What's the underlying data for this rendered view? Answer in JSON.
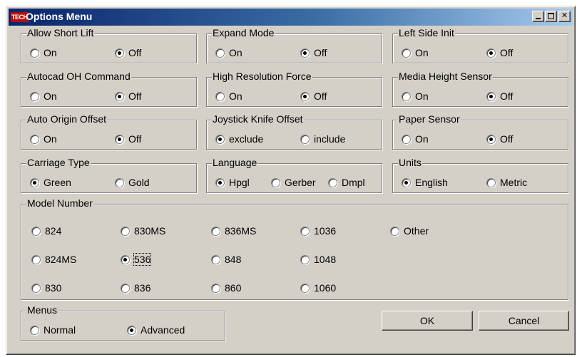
{
  "window": {
    "logo": "TECH",
    "title": "Options Menu"
  },
  "groups": {
    "allow_short_lift": {
      "title": "Allow Short Lift",
      "options": [
        "On",
        "Off"
      ],
      "selected": "Off"
    },
    "expand_mode": {
      "title": "Expand Mode",
      "options": [
        "On",
        "Off"
      ],
      "selected": "Off"
    },
    "left_side_init": {
      "title": "Left Side Init",
      "options": [
        "On",
        "Off"
      ],
      "selected": "Off"
    },
    "autocad_oh": {
      "title": "Autocad OH Command",
      "options": [
        "On",
        "Off"
      ],
      "selected": "Off"
    },
    "high_res": {
      "title": "High Resolution Force",
      "options": [
        "On",
        "Off"
      ],
      "selected": "Off"
    },
    "media_height": {
      "title": "Media Height Sensor",
      "options": [
        "On",
        "Off"
      ],
      "selected": "Off"
    },
    "auto_origin": {
      "title": "Auto Origin Offset",
      "options": [
        "On",
        "Off"
      ],
      "selected": "Off"
    },
    "joystick_knife": {
      "title": "Joystick Knife Offset",
      "options": [
        "exclude",
        "include"
      ],
      "selected": "exclude"
    },
    "paper_sensor": {
      "title": "Paper Sensor",
      "options": [
        "On",
        "Off"
      ],
      "selected": "Off"
    },
    "carriage_type": {
      "title": "Carriage Type",
      "options": [
        "Green",
        "Gold"
      ],
      "selected": "Green"
    },
    "language": {
      "title": "Language",
      "options": [
        "Hpgl",
        "Gerber",
        "Dmpl"
      ],
      "selected": "Hpgl"
    },
    "units": {
      "title": "Units",
      "options": [
        "English",
        "Metric"
      ],
      "selected": "English"
    },
    "model_number": {
      "title": "Model Number",
      "options": [
        "824",
        "830MS",
        "836MS",
        "1036",
        "Other",
        "824MS",
        "536",
        "848",
        "1048",
        "830",
        "836",
        "860",
        "1060"
      ],
      "selected": "536"
    },
    "menus": {
      "title": "Menus",
      "options": [
        "Normal",
        "Advanced"
      ],
      "selected": "Advanced"
    }
  },
  "buttons": {
    "ok": "OK",
    "cancel": "Cancel"
  }
}
